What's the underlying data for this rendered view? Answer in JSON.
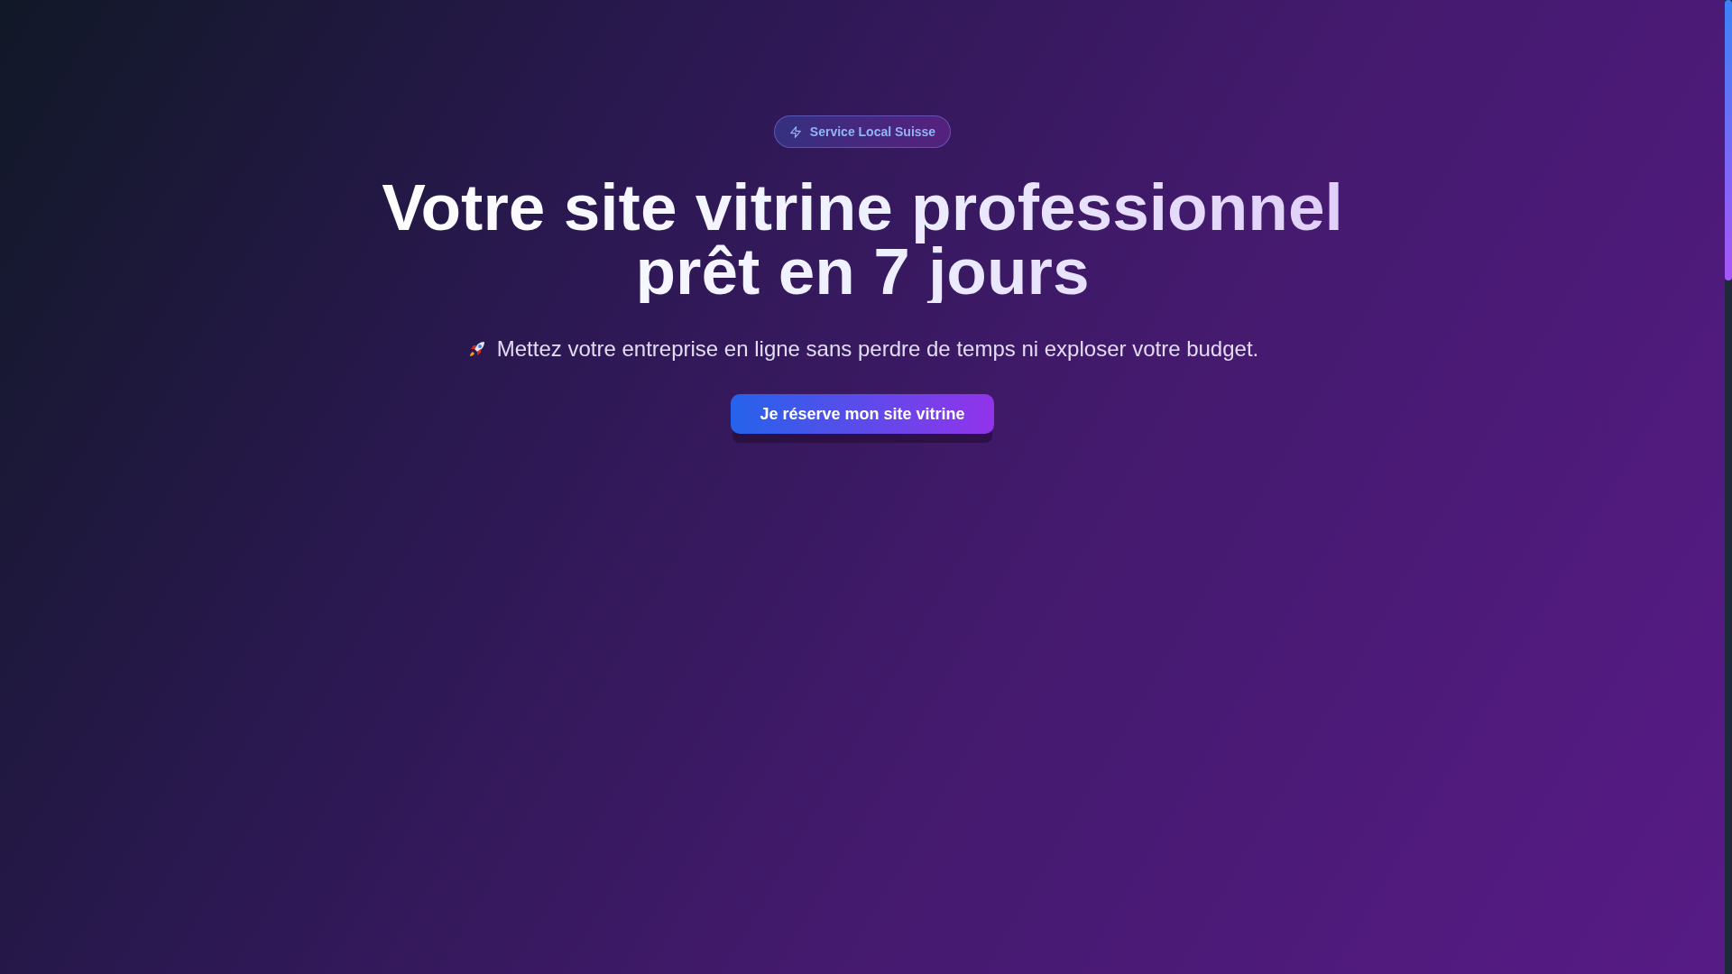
{
  "hero": {
    "badge": "Service Local Suisse",
    "title_lines": [
      "Votre site vitrine professionnel",
      "prêt en 7 jours"
    ],
    "subtitle": "Mettez votre entreprise en ligne sans perdre de temps ni exploser votre budget.",
    "cta": "Je réserve mon site vitrine"
  }
}
